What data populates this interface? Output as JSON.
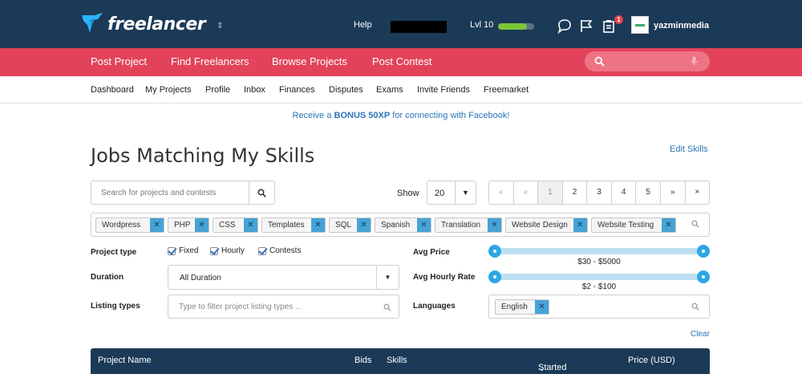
{
  "header": {
    "logo_text": "freelancer",
    "help_label": "Help",
    "level_label": "Lvl 10",
    "level_progress": 0.8,
    "notification_count": "1",
    "username": "yazminmedia"
  },
  "main_nav": {
    "items": [
      {
        "label": "Post Project"
      },
      {
        "label": "Find Freelancers"
      },
      {
        "label": "Browse Projects"
      },
      {
        "label": "Post Contest"
      }
    ]
  },
  "sub_nav": {
    "items": [
      {
        "label": "Dashboard"
      },
      {
        "label": "My Projects"
      },
      {
        "label": "Profile"
      },
      {
        "label": "Inbox"
      },
      {
        "label": "Finances"
      },
      {
        "label": "Disputes"
      },
      {
        "label": "Exams"
      },
      {
        "label": "Invite Friends"
      },
      {
        "label": "Freemarket"
      }
    ]
  },
  "promo": {
    "prefix": "Receive a ",
    "bonus": "BONUS 50XP",
    "suffix": " for connecting with Facebook!"
  },
  "page": {
    "title": "Jobs Matching My Skills",
    "edit_skills": "Edit Skills"
  },
  "search": {
    "placeholder": "Search for projects and contests",
    "value": ""
  },
  "show": {
    "label": "Show",
    "selected": "20"
  },
  "pagination": [
    "«",
    "‹",
    "1",
    "2",
    "3",
    "4",
    "5",
    "»",
    "×"
  ],
  "pagination_display": [
    "«",
    "«",
    "1",
    "2",
    "3",
    "4",
    "5",
    "»",
    "×"
  ],
  "skill_tags": [
    "Wordpress",
    "PHP",
    "CSS",
    "Templates",
    "SQL",
    "Spanish",
    "Translation",
    "Website Design",
    "Website Testing"
  ],
  "filters": {
    "project_type_label": "Project type",
    "project_types": [
      {
        "label": "Fixed",
        "checked": true
      },
      {
        "label": "Hourly",
        "checked": true
      },
      {
        "label": "Contests",
        "checked": true
      }
    ],
    "duration_label": "Duration",
    "duration_value": "All Duration",
    "listing_types_label": "Listing types",
    "listing_types_placeholder": "Type to filter project listing types ...",
    "avg_price_label": "Avg Price",
    "avg_price_range": "$30 - $5000",
    "avg_hourly_label": "Avg Hourly Rate",
    "avg_hourly_range": "$2 - $100",
    "languages_label": "Languages",
    "languages": [
      "English"
    ],
    "clear_label": "Clear"
  },
  "table": {
    "columns": {
      "project_name": "Project Name",
      "bids": "Bids",
      "skills": "Skills",
      "started": "Started",
      "price": "Price (USD)"
    }
  }
}
